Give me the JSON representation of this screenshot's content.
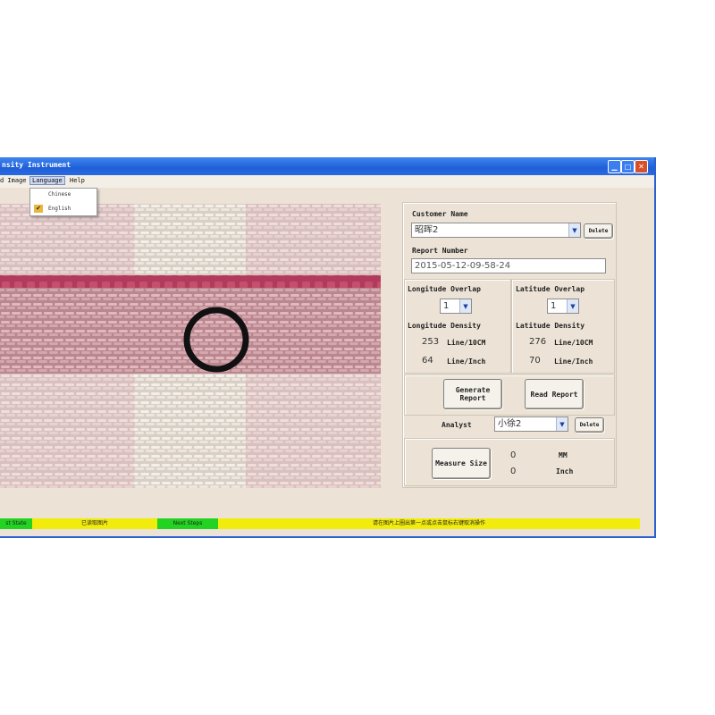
{
  "window": {
    "title": "nsity Instrument"
  },
  "menu": {
    "items": [
      "d Image",
      "Language",
      "Help"
    ]
  },
  "language_menu": {
    "items": [
      "Chinese",
      "English"
    ],
    "checked": "English"
  },
  "customer": {
    "label": "Customer Name",
    "value": "昭晖2",
    "delete_label": "Delete"
  },
  "report": {
    "label": "Report Number",
    "value": "2015-05-12-09-58-24"
  },
  "longitude": {
    "overlap_label": "Longitude Overlap",
    "overlap_value": "1",
    "density_label": "Longitude Density",
    "per_10cm_value": "253",
    "per_10cm_unit": "Line/10CM",
    "per_inch_value": "64",
    "per_inch_unit": "Line/Inch"
  },
  "latitude": {
    "overlap_label": "Latitude Overlap",
    "overlap_value": "1",
    "density_label": "Latitude Density",
    "per_10cm_value": "276",
    "per_10cm_unit": "Line/10CM",
    "per_inch_value": "70",
    "per_inch_unit": "Line/Inch"
  },
  "actions": {
    "generate_report": "Generate Report",
    "read_report": "Read Report"
  },
  "analyst": {
    "label": "Analyst",
    "value": "小徐2",
    "delete_label": "Delete"
  },
  "measure": {
    "button_label": "Measure Size",
    "mm_value": "0",
    "mm_unit": "MM",
    "inch_value": "0",
    "inch_unit": "Inch"
  },
  "status": {
    "segments": [
      "st State",
      "已读取图片",
      "Next Steps",
      "请在图片上圈出第一点或点击鼠标右键取消操作"
    ],
    "colors": {
      "green": "#22d322",
      "yellow": "#f2ec0c"
    }
  },
  "icons": {
    "minimize": "minimize-icon",
    "maximize": "maximize-icon",
    "close": "close-icon"
  }
}
